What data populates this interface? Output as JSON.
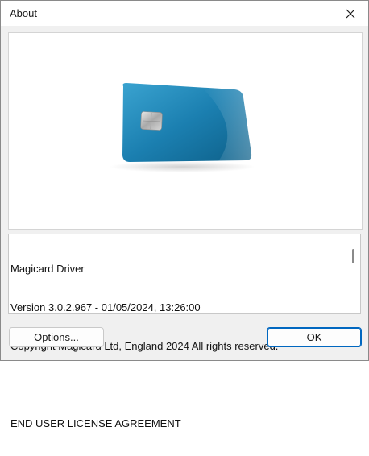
{
  "window": {
    "title": "About"
  },
  "icons": {
    "close": "close-icon",
    "card": "id-card-icon"
  },
  "info": {
    "lines": [
      "Magicard Driver",
      "Version 3.0.2.967 - 01/05/2024, 13:26:00",
      "Copyright Magicard Ltd, England 2024 All rights reserved.",
      "",
      "END USER LICENSE AGREEMENT"
    ]
  },
  "buttons": {
    "options_label": "Options...",
    "ok_label": "OK"
  },
  "colors": {
    "accent": "#0067c0",
    "card_blue": "#1a78a8"
  }
}
